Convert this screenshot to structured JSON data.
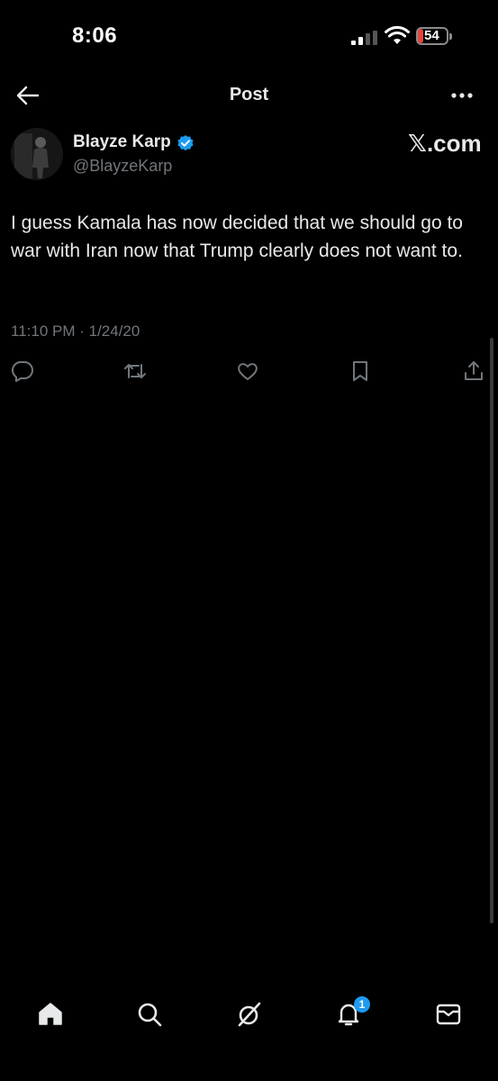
{
  "status_bar": {
    "time": "8:06",
    "battery": "54"
  },
  "header": {
    "title": "Post"
  },
  "author": {
    "name": "Blayze Karp",
    "handle": "@BlayzeKarp",
    "source": "𝕏.com"
  },
  "post": {
    "text": "I guess Kamala has now decided that we should go to war with Iran now that Trump clearly does not want to.",
    "timestamp": "11:10 PM · 1/24/20"
  },
  "nav": {
    "notifications_badge": "1"
  },
  "colors": {
    "accent": "#1d9bf0",
    "text": "#e7e9ea",
    "muted": "#71767b",
    "background": "#000000"
  },
  "icons": [
    "back-arrow-icon",
    "more-icon",
    "verified-icon",
    "reply-icon",
    "repost-icon",
    "like-icon",
    "bookmark-icon",
    "share-icon",
    "home-icon",
    "search-icon",
    "grok-icon",
    "notifications-icon",
    "messages-icon"
  ]
}
